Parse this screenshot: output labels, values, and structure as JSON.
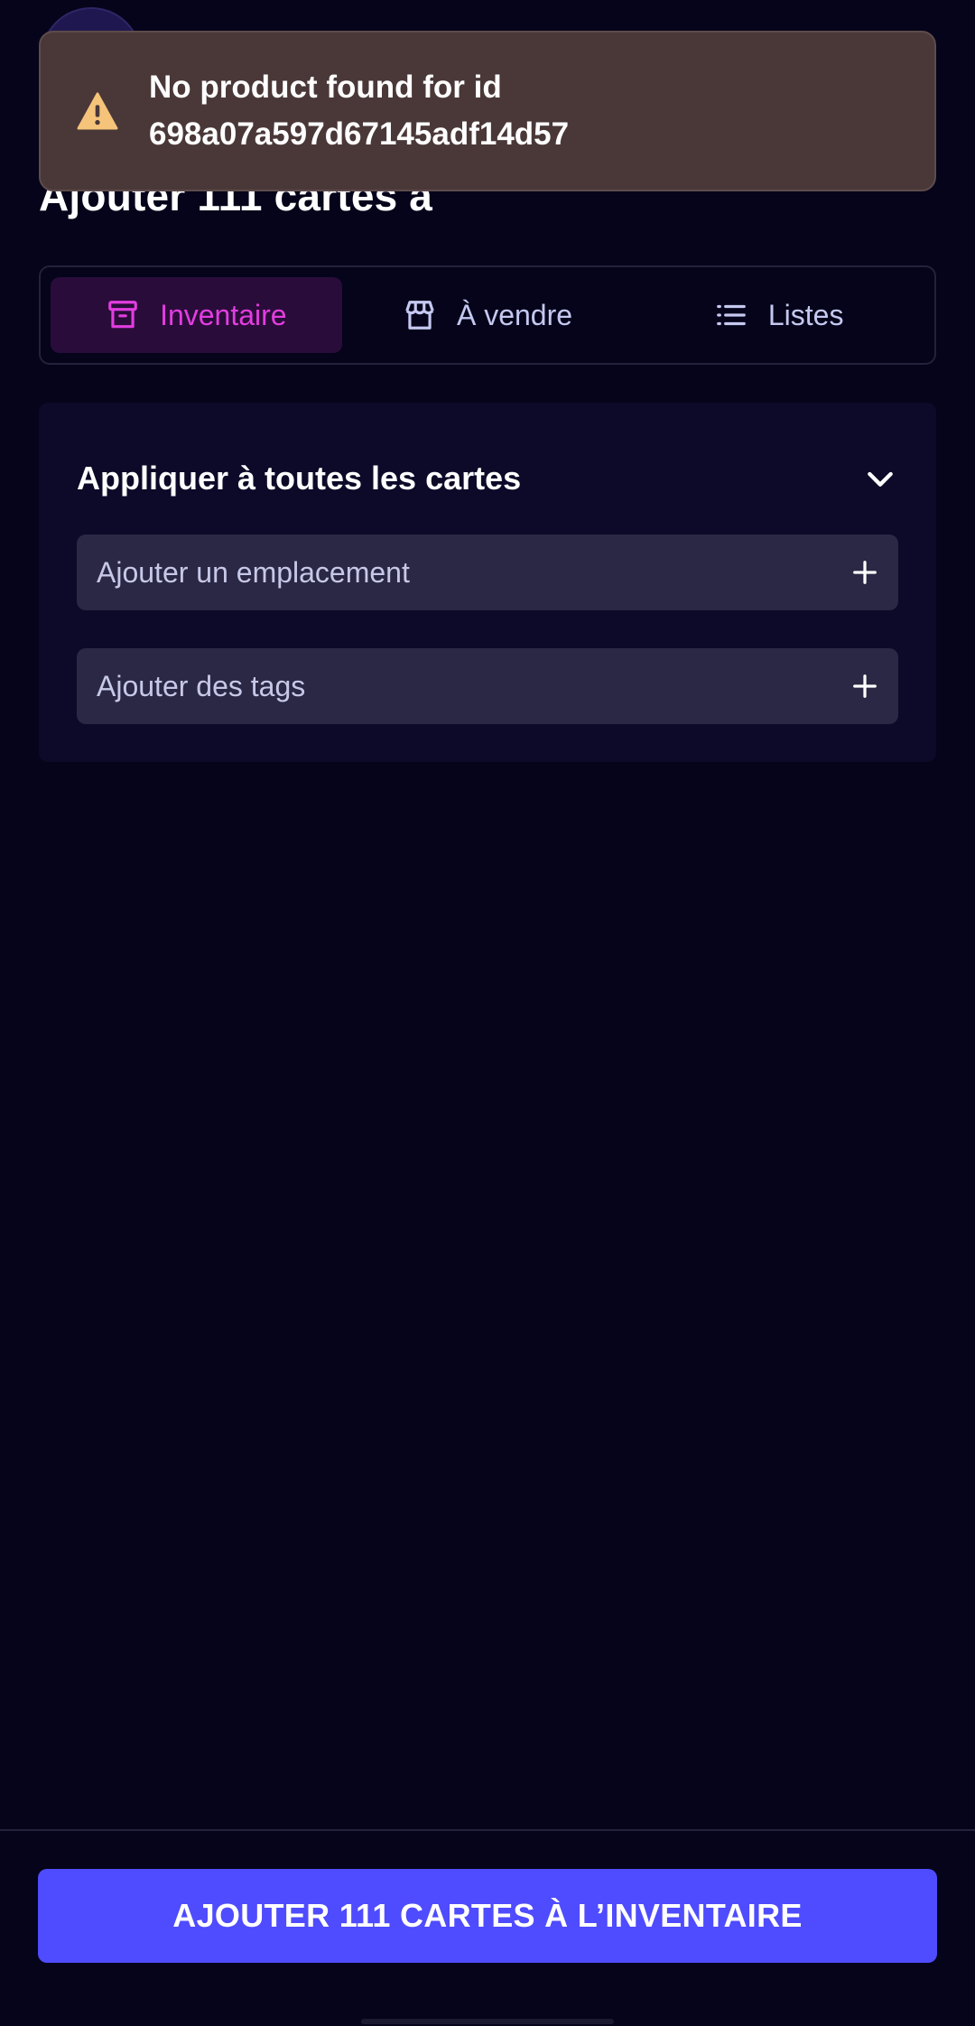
{
  "header": {
    "title": "Ajouter 111 cartes à"
  },
  "toast": {
    "line1": "No product found for id",
    "line2": "698a07a597d67145adf14d57",
    "icon": "warning-icon",
    "color": "#4a3838"
  },
  "tabs": [
    {
      "label": "Inventaire",
      "icon": "archive-icon",
      "active": true
    },
    {
      "label": "À vendre",
      "icon": "store-icon",
      "active": false
    },
    {
      "label": "Listes",
      "icon": "list-icon",
      "active": false
    }
  ],
  "panel": {
    "title": "Appliquer à toutes les cartes",
    "expanded": true,
    "fields": [
      {
        "label": "Ajouter un emplacement"
      },
      {
        "label": "Ajouter des tags"
      }
    ]
  },
  "cta": {
    "label": "AJOUTER 111 CARTES À L’INVENTAIRE",
    "color": "#4f4bff"
  },
  "colors": {
    "background": "#05041a",
    "accent": "#e23de0"
  }
}
